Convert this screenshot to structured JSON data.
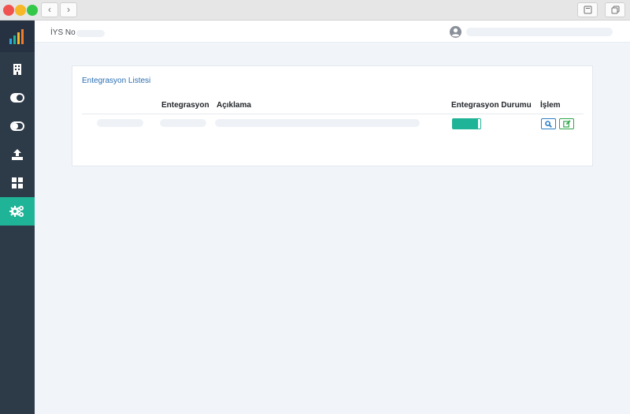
{
  "header": {
    "iys_label": "İYS No :"
  },
  "card": {
    "title": "Entegrasyon Listesi",
    "columns": [
      "",
      "Entegrasyon",
      "Açıklama",
      "Entegrasyon Durumu",
      "İşlem"
    ],
    "rows": [
      {
        "status_enabled": true,
        "status_fill_percent": 90
      }
    ]
  },
  "colors": {
    "sidebar_bg": "#2d3a48",
    "sidebar_active": "#1fb497",
    "title_blue": "#2a6fb3",
    "toggle_green": "#1fb497",
    "view_button": "#2d7fc6",
    "edit_button": "#2ea54a"
  },
  "icons": {
    "sidebar": [
      "bar-chart-logo-icon",
      "building-icon",
      "toggle-on-icon",
      "toggle-off-icon",
      "upload-icon",
      "grid-icon",
      "gears-icon"
    ],
    "actions": [
      "search-icon",
      "edit-icon"
    ],
    "header": [
      "user-circle-icon"
    ],
    "chrome": [
      "chevron-left-icon",
      "chevron-right-icon",
      "window-icon",
      "copy-icon"
    ]
  }
}
